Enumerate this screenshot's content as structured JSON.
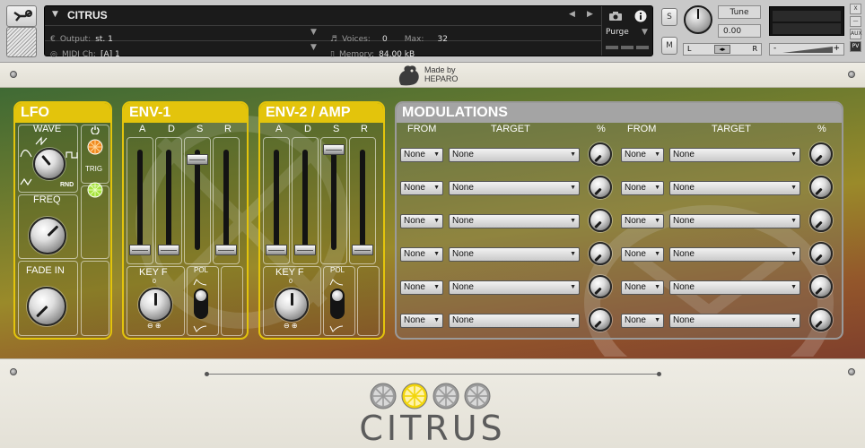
{
  "header": {
    "instrument_name": "CITRUS",
    "output_label": "Output:",
    "output_value": "st. 1",
    "midi_label": "MIDI Ch:",
    "midi_value": "[A]  1",
    "voices_label": "Voices:",
    "voices_value": "0",
    "max_label": "Max:",
    "max_value": "32",
    "memory_label": "Memory:",
    "memory_value": "84.00 kB",
    "purge_label": "Purge",
    "solo_label": "S",
    "mute_label": "M",
    "tune_label": "Tune",
    "tune_value": "0.00",
    "pan_left": "L",
    "pan_right": "R",
    "vol_minus": "-",
    "vol_plus": "+",
    "side_buttons": [
      "X",
      "—",
      "AUX",
      "PV"
    ]
  },
  "branding": {
    "made_by_line1": "Made by",
    "made_by_line2": "HEPARO",
    "wordmark": "CITRUS"
  },
  "lfo": {
    "title": "LFO",
    "wave_label": "WAVE",
    "rnd_label": "RND",
    "trig_label": "TRIG",
    "freq_label": "FREQ",
    "fade_in_label": "FADE IN"
  },
  "env1": {
    "title": "ENV-1",
    "adsr": [
      "A",
      "D",
      "S",
      "R"
    ],
    "levels": [
      0.0,
      0.0,
      0.9,
      0.0
    ],
    "keyf_label": "KEY F",
    "keyf_zero": "0",
    "pol_label": "POL"
  },
  "env2": {
    "title": "ENV-2 / AMP",
    "adsr": [
      "A",
      "D",
      "S",
      "R"
    ],
    "levels": [
      0.0,
      0.0,
      1.0,
      0.0
    ],
    "keyf_label": "KEY F",
    "keyf_zero": "0",
    "pol_label": "POL"
  },
  "modulations": {
    "title": "MODULATIONS",
    "col_from": "FROM",
    "col_target": "TARGET",
    "col_percent": "%",
    "left": [
      {
        "from": "None",
        "target": "None"
      },
      {
        "from": "None",
        "target": "None"
      },
      {
        "from": "None",
        "target": "None"
      },
      {
        "from": "None",
        "target": "None"
      },
      {
        "from": "None",
        "target": "None"
      },
      {
        "from": "None",
        "target": "None"
      }
    ],
    "right": [
      {
        "from": "None",
        "target": "None"
      },
      {
        "from": "None",
        "target": "None"
      },
      {
        "from": "None",
        "target": "None"
      },
      {
        "from": "None",
        "target": "None"
      },
      {
        "from": "None",
        "target": "None"
      },
      {
        "from": "None",
        "target": "None"
      }
    ]
  }
}
